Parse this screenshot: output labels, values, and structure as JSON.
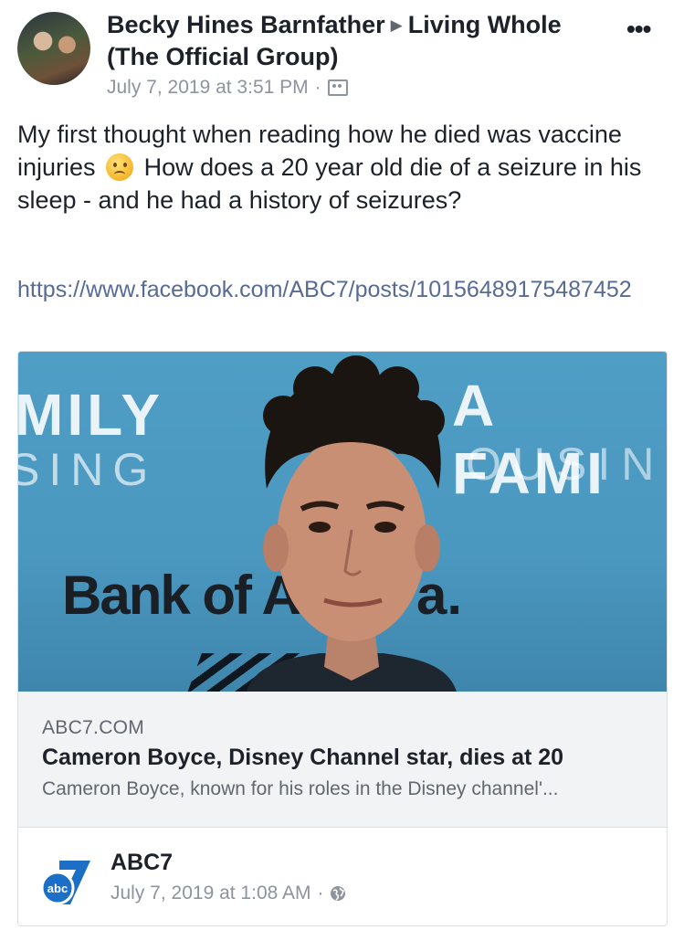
{
  "post": {
    "author": "Becky Hines Barnfather",
    "separator": "▶",
    "group": "Living Whole (The Official Group)",
    "timestamp": "July 7, 2019 at 3:51 PM",
    "dot": "·",
    "text_part1": "My first thought when reading how he died was vaccine injuries",
    "text_part2": "How does a 20 year old die of a seizure in his sleep - and he had a history of seizures?",
    "link": "https://www.facebook.com/ABC7/posts/10156489175487452"
  },
  "icons": {
    "more": "more-options-icon",
    "emoji": "frowning-face-emoji",
    "audience": "group-audience-icon",
    "globe": "globe-icon",
    "source_logo": "abc7-logo"
  },
  "image_text": {
    "left_line1": "MILY",
    "left_line2": "SING",
    "right_line1": "A FAMI",
    "right_line2": "OUSIN",
    "bank_left": "Bank of A",
    "bank_right": "a."
  },
  "shared_card": {
    "domain": "ABC7.COM",
    "title": "Cameron Boyce, Disney Channel star, dies at 20",
    "description": "Cameron Boyce, known for his roles in the Disney channel'..."
  },
  "source": {
    "name": "ABC7",
    "timestamp": "July 7, 2019 at 1:08 AM",
    "dot": "·",
    "logo_text": "abc"
  },
  "colors": {
    "link": "#576b95",
    "meta_text": "#8d949e",
    "card_bg": "#f2f3f5",
    "image_bg": "#4a97bf",
    "abc_blue": "#1c6fc6"
  }
}
